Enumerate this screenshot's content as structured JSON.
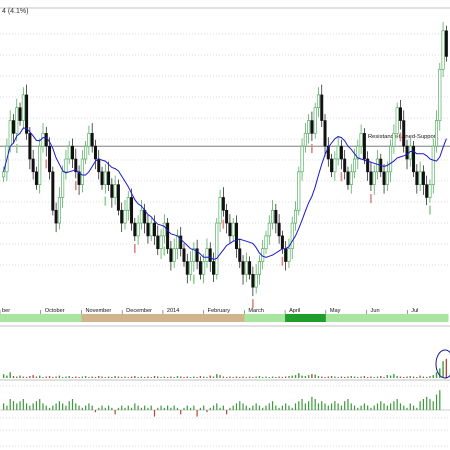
{
  "header": {
    "info_text": "4 (4.1%)"
  },
  "annotation": {
    "text": "Resistance-turned-Support",
    "level": 0.72
  },
  "colors": {
    "up": "#3fa34d",
    "up_fill": "#ffffff",
    "down": "#111111",
    "down_fill": "#111111",
    "ma": "#1a1acc",
    "sma_marker_up": "#8fd18f",
    "sma_marker_down": "#d98a80",
    "level_line": "#6b6b6b",
    "grid": "#bbbbbb",
    "band_green_light": "#a8e6a0",
    "band_tan": "#d2b48c",
    "band_green_dark": "#1f9e2c",
    "volume_up": "#3a9a3a",
    "volume_down": "#b04a3a",
    "circle": "#1a1a8c"
  },
  "chart_data": {
    "type": "candlestick",
    "x_tick_labels": [
      "ber",
      "October",
      "November",
      "December",
      "2014",
      "February",
      "March",
      "April",
      "May",
      "Jun",
      "Jul"
    ],
    "candles_price_range": [
      0.6,
      0.82
    ],
    "ma_period_hint": "moving average",
    "band_segments": [
      {
        "month": "ber",
        "color": "band_green_light"
      },
      {
        "month": "October",
        "color": "band_green_light"
      },
      {
        "month": "November",
        "color": "band_tan"
      },
      {
        "month": "December",
        "color": "band_tan"
      },
      {
        "month": "2014",
        "color": "band_tan"
      },
      {
        "month": "February",
        "color": "band_tan"
      },
      {
        "month": "March",
        "color": "band_green_light"
      },
      {
        "month": "April",
        "color": "band_green_dark"
      },
      {
        "month": "May",
        "color": "band_green_light"
      },
      {
        "month": "Jun",
        "color": "band_green_light"
      },
      {
        "month": "Jul",
        "color": "band_green_light"
      }
    ],
    "close_series": [
      0.7,
      0.72,
      0.74,
      0.73,
      0.75,
      0.74,
      0.76,
      0.73,
      0.71,
      0.7,
      0.69,
      0.72,
      0.73,
      0.72,
      0.7,
      0.67,
      0.66,
      0.68,
      0.7,
      0.71,
      0.72,
      0.71,
      0.7,
      0.69,
      0.71,
      0.72,
      0.73,
      0.72,
      0.71,
      0.7,
      0.69,
      0.7,
      0.69,
      0.68,
      0.69,
      0.67,
      0.66,
      0.67,
      0.68,
      0.66,
      0.65,
      0.66,
      0.67,
      0.66,
      0.65,
      0.66,
      0.65,
      0.64,
      0.65,
      0.66,
      0.64,
      0.63,
      0.64,
      0.65,
      0.64,
      0.63,
      0.62,
      0.63,
      0.64,
      0.63,
      0.62,
      0.63,
      0.64,
      0.63,
      0.62,
      0.66,
      0.68,
      0.67,
      0.66,
      0.65,
      0.66,
      0.64,
      0.63,
      0.62,
      0.63,
      0.62,
      0.61,
      0.62,
      0.63,
      0.64,
      0.65,
      0.66,
      0.67,
      0.66,
      0.65,
      0.64,
      0.63,
      0.64,
      0.66,
      0.67,
      0.7,
      0.72,
      0.73,
      0.74,
      0.73,
      0.75,
      0.76,
      0.74,
      0.72,
      0.71,
      0.7,
      0.71,
      0.72,
      0.71,
      0.7,
      0.69,
      0.7,
      0.71,
      0.72,
      0.73,
      0.71,
      0.7,
      0.69,
      0.7,
      0.71,
      0.7,
      0.69,
      0.7,
      0.72,
      0.73,
      0.75,
      0.74,
      0.72,
      0.71,
      0.72,
      0.7,
      0.69,
      0.7,
      0.69,
      0.68,
      0.69,
      0.72,
      0.74,
      0.78,
      0.81,
      0.79
    ],
    "volume_series": [
      0.08,
      0.05,
      0.12,
      0.04,
      0.03,
      0.05,
      0.03,
      0.02,
      0.04,
      0.06,
      0.03,
      0.05,
      0.02,
      0.03,
      0.04,
      0.02,
      0.03,
      0.05,
      0.02,
      0.03,
      0.04,
      0.02,
      0.03,
      0.02,
      0.03,
      0.04,
      0.02,
      0.03,
      0.02,
      0.04,
      0.03,
      0.02,
      0.03,
      0.02,
      0.04,
      0.03,
      0.02,
      0.03,
      0.02,
      0.03,
      0.04,
      0.02,
      0.03,
      0.02,
      0.03,
      0.02,
      0.04,
      0.03,
      0.02,
      0.03,
      0.02,
      0.03,
      0.02,
      0.04,
      0.03,
      0.02,
      0.03,
      0.02,
      0.03,
      0.02,
      0.04,
      0.03,
      0.02,
      0.05,
      0.03,
      0.08,
      0.06,
      0.03,
      0.02,
      0.03,
      0.02,
      0.03,
      0.02,
      0.03,
      0.02,
      0.03,
      0.02,
      0.03,
      0.04,
      0.02,
      0.03,
      0.02,
      0.03,
      0.02,
      0.03,
      0.02,
      0.03,
      0.04,
      0.05,
      0.06,
      0.1,
      0.05,
      0.04,
      0.06,
      0.08,
      0.07,
      0.04,
      0.03,
      0.02,
      0.03,
      0.04,
      0.03,
      0.02,
      0.03,
      0.02,
      0.03,
      0.04,
      0.03,
      0.02,
      0.03,
      0.04,
      0.02,
      0.03,
      0.02,
      0.03,
      0.04,
      0.02,
      0.06,
      0.05,
      0.08,
      0.04,
      0.03,
      0.02,
      0.03,
      0.04,
      0.03,
      0.02,
      0.05,
      0.03,
      0.02,
      0.04,
      0.06,
      0.12,
      0.2,
      0.35,
      0.4
    ],
    "osc_series": [
      0.3,
      0.2,
      0.5,
      0.4,
      0.3,
      0.4,
      0.5,
      0.3,
      0.2,
      0.3,
      0.4,
      0.5,
      0.3,
      0.2,
      0.1,
      0.2,
      0.3,
      0.4,
      0.3,
      0.2,
      0.4,
      0.5,
      0.3,
      0.2,
      0.1,
      0.2,
      0.3,
      0.2,
      -0.1,
      0.1,
      0.2,
      0.1,
      0.2,
      0.1,
      -0.2,
      0.1,
      0.2,
      0.1,
      0.2,
      0.1,
      0.3,
      0.2,
      0.1,
      0.2,
      0.1,
      0.2,
      -0.3,
      0.1,
      0.2,
      0.1,
      0.2,
      0.1,
      0.2,
      0.1,
      -0.2,
      0.1,
      0.2,
      0.1,
      0.2,
      -0.3,
      0.1,
      0.2,
      -0.1,
      0.1,
      0.2,
      0.3,
      0.1,
      0.2,
      -0.2,
      0.1,
      0.2,
      0.3,
      0.4,
      0.3,
      0.2,
      0.1,
      0.2,
      0.3,
      0.2,
      0.1,
      0.2,
      0.3,
      0.4,
      0.2,
      0.1,
      0.2,
      0.3,
      0.2,
      0.1,
      0.3,
      0.4,
      0.5,
      0.3,
      0.4,
      0.6,
      0.5,
      0.3,
      0.4,
      0.3,
      0.2,
      0.3,
      0.4,
      0.3,
      0.2,
      0.4,
      0.5,
      0.3,
      0.2,
      0.1,
      0.2,
      0.3,
      0.2,
      0.1,
      0.2,
      0.3,
      0.4,
      0.3,
      0.2,
      0.3,
      0.4,
      0.5,
      0.3,
      0.2,
      0.1,
      0.3,
      0.2,
      0.1,
      0.4,
      0.5,
      0.6,
      0.5,
      0.4,
      0.7,
      0.9
    ]
  }
}
